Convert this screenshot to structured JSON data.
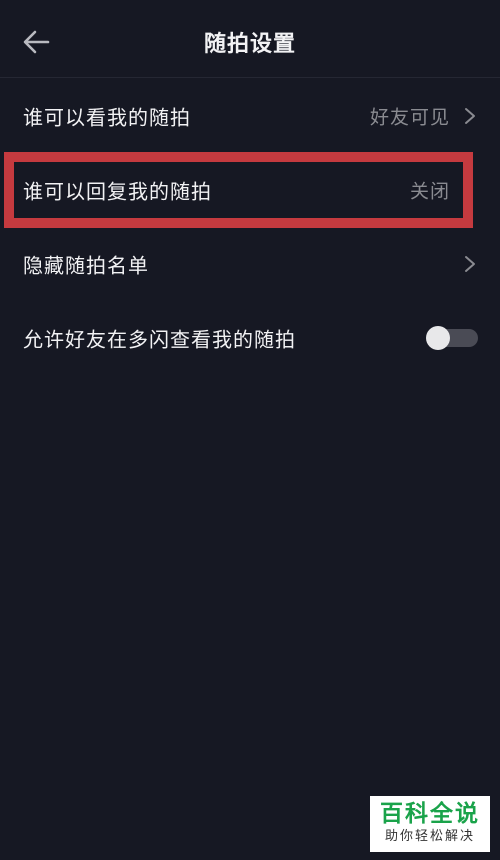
{
  "header": {
    "title": "随拍设置",
    "back_icon": "arrow-left-icon"
  },
  "settings": [
    {
      "label": "谁可以看我的随拍",
      "value": "好友可见",
      "icon": "chevron-right-icon"
    },
    {
      "label": "谁可以回复我的随拍",
      "value": "关闭",
      "highlighted": true
    },
    {
      "label": "隐藏随拍名单",
      "icon": "chevron-right-icon"
    },
    {
      "label": "允许好友在多闪查看我的随拍",
      "toggle_on": false
    }
  ],
  "watermark": {
    "title": "百科全说",
    "subtitle": "助你轻松解决"
  },
  "colors": {
    "background": "#161823",
    "text": "#f2f2f4",
    "muted": "#8a8b91",
    "highlight": "#c53a3f",
    "watermark_green": "#1aa34a"
  }
}
